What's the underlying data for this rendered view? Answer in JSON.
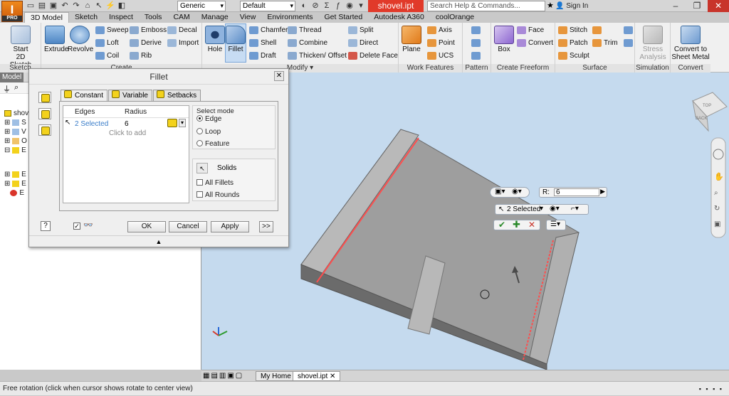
{
  "app": {
    "logo_letter": "I",
    "logo_sub": "PRO",
    "doc_title": "shovel.ipt"
  },
  "titlebar": {
    "material_combo": "Generic",
    "appearance_combo": "Default",
    "help_search_placeholder": "Search Help & Commands...",
    "sign_in": "Sign In"
  },
  "ribbon_tabs": [
    "3D Model",
    "Sketch",
    "Inspect",
    "Tools",
    "CAM",
    "Manage",
    "View",
    "Environments",
    "Get Started",
    "Autodesk A360",
    "coolOrange"
  ],
  "ribbon": {
    "sketch": {
      "label": "Sketch",
      "start": "Start",
      "start2": "2D Sketch"
    },
    "create": {
      "label": "Create",
      "extrude": "Extrude",
      "revolve": "Revolve",
      "sweep": "Sweep",
      "loft": "Loft",
      "coil": "Coil",
      "emboss": "Emboss",
      "derive": "Derive",
      "rib": "Rib",
      "decal": "Decal",
      "import": "Import"
    },
    "modify": {
      "label": "Modify",
      "hole": "Hole",
      "fillet": "Fillet",
      "chamfer": "Chamfer",
      "shell": "Shell",
      "draft": "Draft",
      "thread": "Thread",
      "combine": "Combine",
      "thicken": "Thicken/ Offset",
      "split": "Split",
      "direct": "Direct",
      "delete_face": "Delete Face"
    },
    "work": {
      "label": "Work Features",
      "plane": "Plane",
      "axis": "Axis",
      "point": "Point",
      "ucs": "UCS"
    },
    "pattern": {
      "label": "Pattern"
    },
    "freeform": {
      "label": "Create Freeform",
      "box": "Box",
      "face": "Face",
      "convert": "Convert"
    },
    "surface": {
      "label": "Surface",
      "stitch": "Stitch",
      "patch": "Patch",
      "sculpt": "Sculpt",
      "trim": "Trim"
    },
    "simulation": {
      "label": "Simulation",
      "stress": "Stress",
      "stress2": "Analysis"
    },
    "convert": {
      "label": "Convert",
      "line1": "Convert to",
      "line2": "Sheet Metal"
    }
  },
  "browser": {
    "tab": "Model",
    "rows": [
      "shov",
      "S",
      "V",
      "O",
      "E",
      "E",
      "E",
      "E"
    ]
  },
  "dialog": {
    "title": "Fillet",
    "tabs": [
      "Constant",
      "Variable",
      "Setbacks"
    ],
    "col_edges": "Edges",
    "col_radius": "Radius",
    "edges_value": "2 Selected",
    "radius_value": "6",
    "click_to_add": "Click to add",
    "select_mode_label": "Select mode",
    "modes": [
      "Edge",
      "Loop",
      "Feature"
    ],
    "solids": "Solids",
    "all_fillets": "All Fillets",
    "all_rounds": "All Rounds",
    "ok": "OK",
    "cancel": "Cancel",
    "apply": "Apply",
    "more": ">>"
  },
  "minitoolbar": {
    "radius_label": "R:",
    "radius_value": "6",
    "selected": "2 Selected"
  },
  "viewcube": {
    "top": "TOP",
    "back": "BACK"
  },
  "doc_tabs": [
    "My Home",
    "shovel.ipt"
  ],
  "status": "Free rotation (click when cursor shows rotate to center view)",
  "colors": {
    "accent": "#e13a2a",
    "viewport": "#c5daee",
    "highlight": "#ff5a5a"
  }
}
